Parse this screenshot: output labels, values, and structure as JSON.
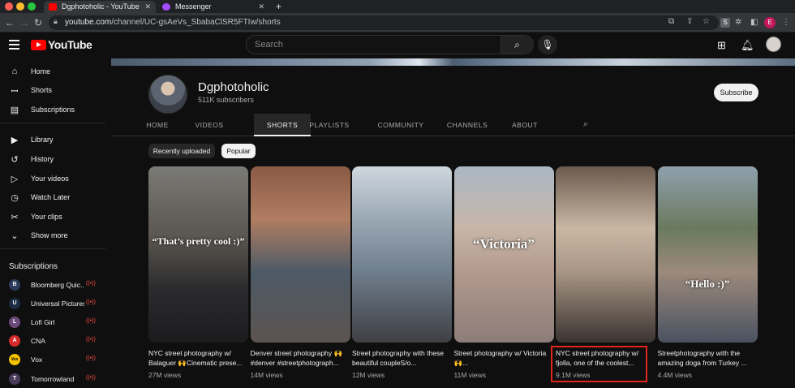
{
  "browser": {
    "tabs": [
      {
        "title": "Dgphotoholic - YouTube",
        "favicon_color": "#ff0000"
      },
      {
        "title": "Messenger",
        "favicon_color": "#a24dff"
      }
    ],
    "new_tab": "+",
    "url_domain": "youtube.com",
    "url_path": "/channel/UC-gsAeVs_SbabaClSR5FTIw/shorts",
    "profile_initial": "E",
    "ext_initial": "S"
  },
  "header": {
    "logo_text": "YouTube",
    "search_placeholder": "Search"
  },
  "sidebar": {
    "items": [
      {
        "label": "Home",
        "icon": "home-icon",
        "glyph": "⌂"
      },
      {
        "label": "Shorts",
        "icon": "shorts-icon",
        "glyph": "ꟷ"
      },
      {
        "label": "Subscriptions",
        "icon": "subscriptions-icon",
        "glyph": "▤"
      },
      {
        "label": "Library",
        "icon": "library-icon",
        "glyph": "▶"
      },
      {
        "label": "History",
        "icon": "history-icon",
        "glyph": "↺"
      },
      {
        "label": "Your videos",
        "icon": "your-videos-icon",
        "glyph": "▷"
      },
      {
        "label": "Watch Later",
        "icon": "watch-later-icon",
        "glyph": "◷"
      },
      {
        "label": "Your clips",
        "icon": "clips-icon",
        "glyph": "✂"
      },
      {
        "label": "Show more",
        "icon": "chevron-down-icon",
        "glyph": "⌄"
      }
    ],
    "subscriptions_heading": "Subscriptions",
    "subscriptions": [
      {
        "name": "Bloomberg Quic...",
        "color": "#2b3b5c",
        "initial": "B"
      },
      {
        "name": "Universal Pictures",
        "color": "#1b2b44",
        "initial": "U"
      },
      {
        "name": "Lofi Girl",
        "color": "#6b4a7a",
        "initial": "L"
      },
      {
        "name": "CNA",
        "color": "#d62b2b",
        "initial": "A"
      },
      {
        "name": "Vox",
        "color": "#f5c400",
        "initial": "Vox"
      },
      {
        "name": "Tomorrowland",
        "color": "#4a3b5a",
        "initial": "T"
      }
    ],
    "live_glyph": "((•))"
  },
  "channel": {
    "name": "Dgphotoholic",
    "subscribers": "511K subscribers",
    "subscribe_label": "Subscribe",
    "tabs": [
      "HOME",
      "VIDEOS",
      "SHORTS",
      "PLAYLISTS",
      "COMMUNITY",
      "CHANNELS",
      "ABOUT"
    ],
    "active_tab": "SHORTS"
  },
  "filters": {
    "recent_label": "Recently uploaded",
    "popular_label": "Popular"
  },
  "shorts": [
    {
      "title": "NYC street photography w/ Balaguer 🙌Cinematic prese...",
      "views": "27M views",
      "overlay": "“That’s pretty cool :)”",
      "bg": "linear-gradient(180deg,#7a7a76 0%,#5a5650 40%,#2b2b2d 70%,#1c1c1e 100%)"
    },
    {
      "title": "Denver street photography 🙌 #denver #streetphotograph...",
      "views": "14M views",
      "overlay": "",
      "bg": "linear-gradient(180deg,#8a5a45 0%,#b07d62 30%,#4d5a66 60%,#5c5450 100%)"
    },
    {
      "title": "Street photography with these beautiful coupleS/o...",
      "views": "12M views",
      "overlay": "",
      "bg": "linear-gradient(180deg,#cfd7de 0%,#9aa8b4 30%,#6f7e8c 60%,#3f3f44 100%)"
    },
    {
      "title": "Street photography w/ Victoria 🙌...",
      "views": "11M views",
      "overlay": "“Victoria”",
      "bg": "linear-gradient(180deg,#aab7c4 0%,#c8b6a9 35%,#b39a8e 60%,#8c7c78 100%)"
    },
    {
      "title": "NYC street photography w/ fjolla, one of the coolest...",
      "views": "9.1M views",
      "overlay": "",
      "bg": "linear-gradient(180deg,#6b5a4d 0%,#c9b7a4 35%,#a89584 60%,#3a3431 100%)"
    },
    {
      "title": "Streetphotography with the amazing doga from Turkey ...",
      "views": "4.4M views",
      "overlay": "“Hello :)”",
      "bg": "linear-gradient(180deg,#8fa0ad 0%,#6a7a5e 35%,#9c8a7c 60%,#4a5260 100%)"
    }
  ]
}
